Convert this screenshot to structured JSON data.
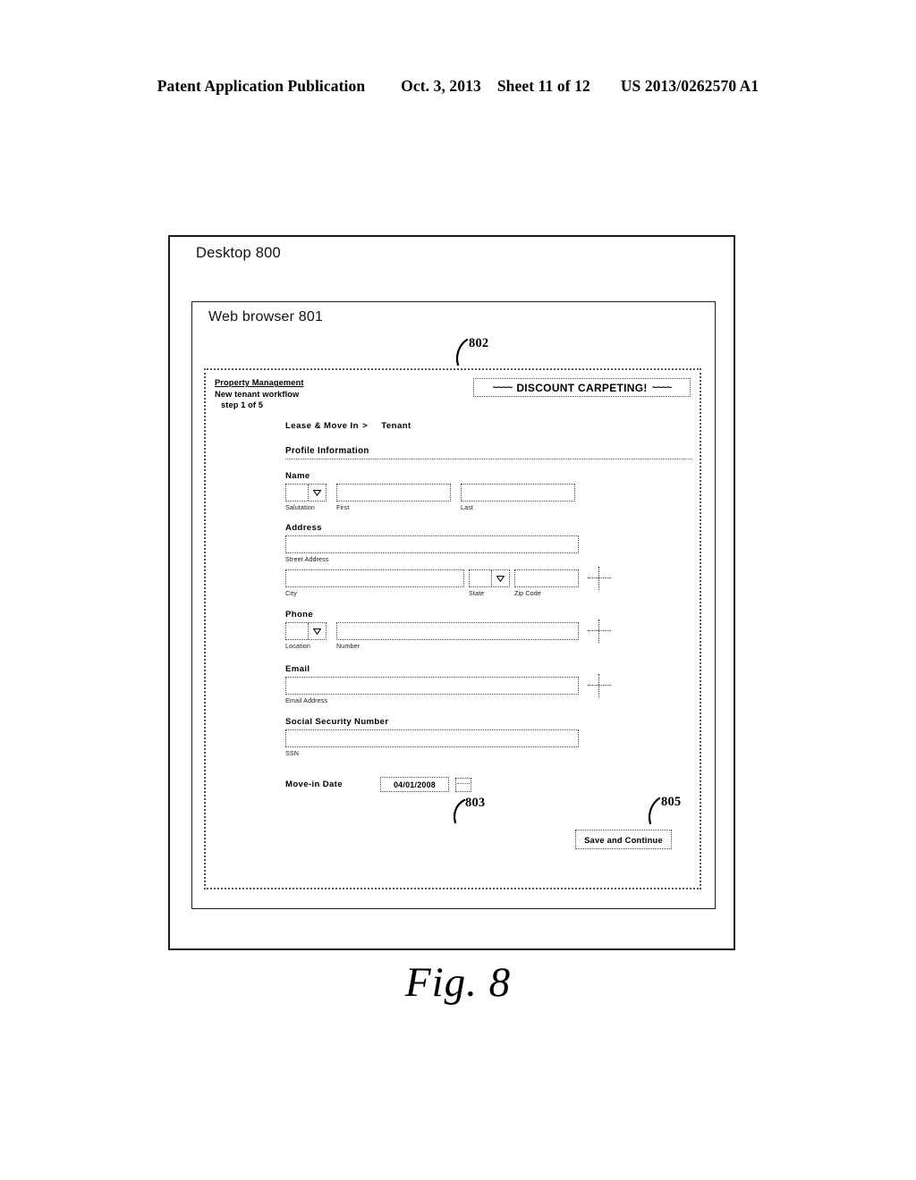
{
  "publication_header": {
    "left": "Patent Application Publication",
    "date": "Oct. 3, 2013",
    "sheet": "Sheet 11 of 12",
    "patent_number": "US 2013/0262570 A1"
  },
  "figure": {
    "caption": "Fig. 8"
  },
  "desktop": {
    "label": "Desktop 800"
  },
  "browser": {
    "label": "Web browser 801"
  },
  "callouts": {
    "webpage": "802",
    "movein_date": "803",
    "save_button": "805"
  },
  "webpage": {
    "site_header": {
      "brand": "Property Management",
      "workflow": "New tenant workflow",
      "step": "step 1 of 5"
    },
    "ad_banner": {
      "left_tilde": "~~~~",
      "text": "DISCOUNT CARPETING!",
      "right_tilde": "~~~~"
    },
    "breadcrumb": {
      "root": "Lease & Move In",
      "separator": ">",
      "leaf": "Tenant"
    },
    "section_title": "Profile Information",
    "groups": [
      {
        "label": "Name",
        "fields": [
          {
            "type": "select",
            "sub_label": "Salutation",
            "value": "",
            "icon": "chevron-down-icon"
          },
          {
            "type": "text",
            "sub_label": "First",
            "value": ""
          },
          {
            "type": "text",
            "sub_label": "Last",
            "value": ""
          }
        ],
        "add_icon": null
      },
      {
        "label": "Address",
        "fields": [
          {
            "type": "text",
            "sub_label": "Street Address",
            "value": ""
          }
        ],
        "add_icon": null
      },
      {
        "label": "",
        "fields": [
          {
            "type": "text",
            "sub_label": "City",
            "value": ""
          },
          {
            "type": "select",
            "sub_label": "State",
            "value": "",
            "icon": "chevron-down-icon"
          },
          {
            "type": "text",
            "sub_label": "Zip Code",
            "value": ""
          }
        ],
        "add_icon": "plus-icon"
      },
      {
        "label": "Phone",
        "fields": [
          {
            "type": "select",
            "sub_label": "Location",
            "value": "",
            "icon": "chevron-down-icon"
          },
          {
            "type": "text",
            "sub_label": "Number",
            "value": ""
          }
        ],
        "add_icon": "plus-icon"
      },
      {
        "label": "Email",
        "fields": [
          {
            "type": "text",
            "sub_label": "Email Address",
            "value": ""
          }
        ],
        "add_icon": "plus-icon"
      },
      {
        "label": "Social Security Number",
        "fields": [
          {
            "type": "text",
            "sub_label": "SSN",
            "value": ""
          }
        ],
        "add_icon": null
      }
    ],
    "movein_date": {
      "label": "Move-in Date",
      "value": "04/01/2008",
      "picker_icon": "calendar-icon"
    },
    "save_button": {
      "label": "Save and Continue"
    }
  }
}
